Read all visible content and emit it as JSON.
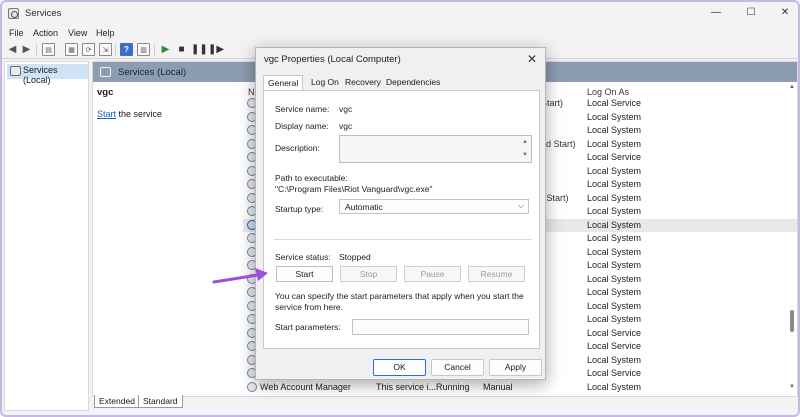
{
  "window": {
    "title": "Services"
  },
  "menu": [
    "File",
    "Action",
    "View",
    "Help"
  ],
  "tree": {
    "item": "Services (Local)"
  },
  "main": {
    "header_title": "Services (Local)",
    "service_title": "vgc",
    "start_link": "Start",
    "start_suffix": " the service",
    "col_name_stub": "Na",
    "col_logon": "Log On As"
  },
  "rows": [
    {
      "trail": "Start)",
      "logon": "Local Service"
    },
    {
      "trail": "",
      "logon": "Local System"
    },
    {
      "trail": "",
      "logon": "Local System"
    },
    {
      "trail": "ed Start)",
      "logon": "Local System"
    },
    {
      "trail": "",
      "logon": "Local Service"
    },
    {
      "trail": "",
      "logon": "Local System"
    },
    {
      "trail": "",
      "logon": "Local System"
    },
    {
      "trail": "r Start)",
      "logon": "Local System"
    },
    {
      "trail": "",
      "logon": "Local System"
    },
    {
      "trail": "",
      "logon": "Local System"
    },
    {
      "trail": "",
      "logon": "Local System"
    },
    {
      "trail": "",
      "logon": "Local System"
    },
    {
      "trail": "",
      "logon": "Local System"
    },
    {
      "trail": "",
      "logon": "Local System"
    },
    {
      "trail": "",
      "logon": "Local System"
    },
    {
      "trail": "",
      "logon": "Local System"
    },
    {
      "trail": "",
      "logon": "Local System"
    },
    {
      "trail": "",
      "logon": "Local Service"
    },
    {
      "trail": "",
      "logon": "Local Service"
    },
    {
      "trail": "",
      "logon": "Local System"
    },
    {
      "trail": "",
      "logon": "Local Service"
    }
  ],
  "last_row": {
    "name": "Web Account Manager",
    "desc": "This service i...",
    "status": "Running",
    "startup": "Manual",
    "logon": "Local System"
  },
  "view_tabs": [
    "Extended",
    "Standard"
  ],
  "dialog": {
    "title": "vgc Properties (Local Computer)",
    "tabs": [
      "General",
      "Log On",
      "Recovery",
      "Dependencies"
    ],
    "service_name_label": "Service name:",
    "service_name": "vgc",
    "display_name_label": "Display name:",
    "display_name": "vgc",
    "description_label": "Description:",
    "path_label": "Path to executable:",
    "path": "\"C:\\Program Files\\Riot Vanguard\\vgc.exe\"",
    "startup_type_label": "Startup type:",
    "startup_type": "Automatic",
    "status_label": "Service status:",
    "status": "Stopped",
    "buttons": {
      "start": "Start",
      "stop": "Stop",
      "pause": "Pause",
      "resume": "Resume"
    },
    "help_text": "You can specify the start parameters that apply when you start the service from here.",
    "params_label": "Start parameters:",
    "ok": "OK",
    "cancel": "Cancel",
    "apply": "Apply"
  },
  "colors": {
    "accent": "#2f6fcf",
    "arrow": "#9b4fe0",
    "header": "#8c9db1"
  }
}
